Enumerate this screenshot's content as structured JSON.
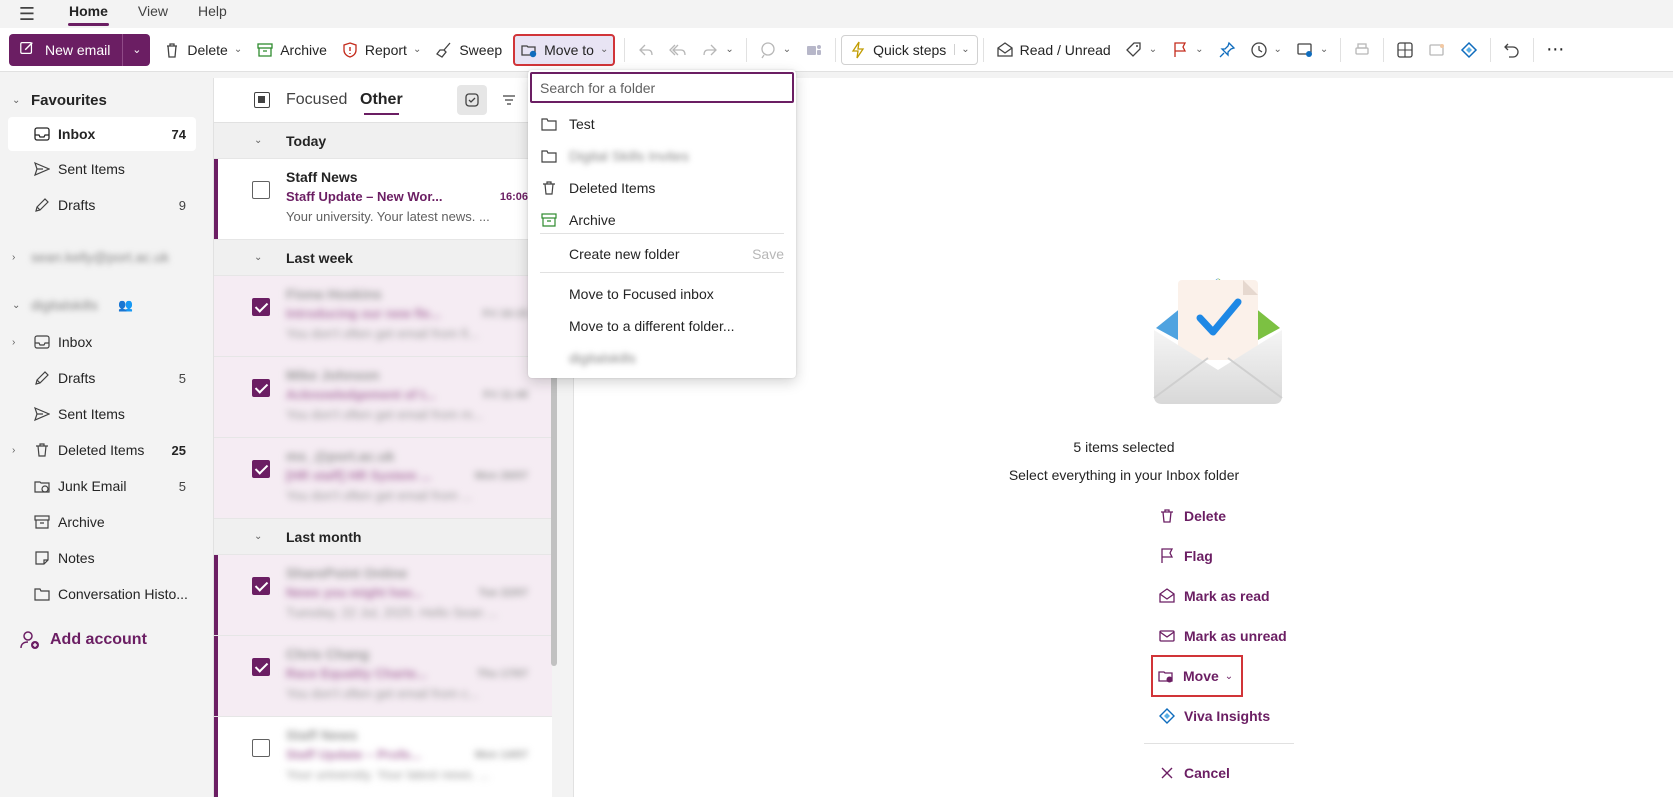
{
  "tabs": [
    "Home",
    "View",
    "Help"
  ],
  "ribbon": {
    "new_email": "New email",
    "delete": "Delete",
    "archive": "Archive",
    "report": "Report",
    "sweep": "Sweep",
    "move_to": "Move to",
    "quick_steps": "Quick steps",
    "read_unread": "Read / Unread",
    "more": "⋯"
  },
  "nav": {
    "favourites": "Favourites",
    "fav_items": [
      {
        "label": "Inbox",
        "count": "74"
      },
      {
        "label": "Sent Items",
        "count": ""
      },
      {
        "label": "Drafts",
        "count": "9"
      }
    ],
    "account1": "sean.kelly@port.ac.uk",
    "account2": "digitalskills",
    "account2_items": [
      {
        "label": "Inbox",
        "count": ""
      },
      {
        "label": "Drafts",
        "count": "5"
      },
      {
        "label": "Sent Items",
        "count": ""
      },
      {
        "label": "Deleted Items",
        "count": "25"
      },
      {
        "label": "Junk Email",
        "count": "5"
      },
      {
        "label": "Archive",
        "count": ""
      },
      {
        "label": "Notes",
        "count": ""
      },
      {
        "label": "Conversation Histo...",
        "count": ""
      }
    ],
    "add_account": "Add account"
  },
  "list": {
    "focused": "Focused",
    "other": "Other",
    "groups": [
      "Today",
      "Last week",
      "Last month"
    ],
    "messages": [
      {
        "from": "Staff News",
        "subject": "Staff Update – New Wor...",
        "time": "16:06",
        "preview": "Your university. Your latest news. ..."
      },
      {
        "from": "Fiona Hoskins",
        "subject": "Introducing our new fle...",
        "time": "Fri 16:15",
        "preview": "You don't often get email from fi..."
      },
      {
        "from": "Mike Johnson",
        "subject": "Acknowledgement of t...",
        "time": "Fri 11:48",
        "preview": "You don't often get email from m..."
      },
      {
        "from": "ms_@port.ac.uk",
        "subject": "[HR staff] HR System ...",
        "time": "Mon 26/07",
        "preview": "You don't often get email from ..."
      },
      {
        "from": "SharePoint Online",
        "subject": "News you might hav...",
        "time": "Tue 22/07",
        "preview": "Tuesday, 22 Jul, 2025. Hello Sean ..."
      },
      {
        "from": "Chris Chang",
        "subject": "Race Equality Charte...",
        "time": "Thu 17/07",
        "preview": "You don't often get email from c..."
      },
      {
        "from": "Staff News",
        "subject": "Staff Update – Profe...",
        "time": "Mon 14/07",
        "preview": "Your university. Your latest news. ..."
      }
    ]
  },
  "reading": {
    "selected_count": "5 items selected",
    "select_all": "Select everything in your Inbox folder",
    "actions": [
      "Delete",
      "Flag",
      "Mark as read",
      "Mark as unread",
      "Move",
      "Viva Insights",
      "Cancel"
    ]
  },
  "dropdown": {
    "search_placeholder": "Search for a folder",
    "folders": [
      "Test",
      "Digital Skills Invites",
      "Deleted Items",
      "Archive"
    ],
    "create_new_folder": "Create new folder",
    "save": "Save",
    "move_focused": "Move to Focused inbox",
    "move_different": "Move to a different folder...",
    "account": "digitalskills"
  },
  "colors": {
    "brand": "#6b1e63",
    "highlight": "#d13438"
  }
}
